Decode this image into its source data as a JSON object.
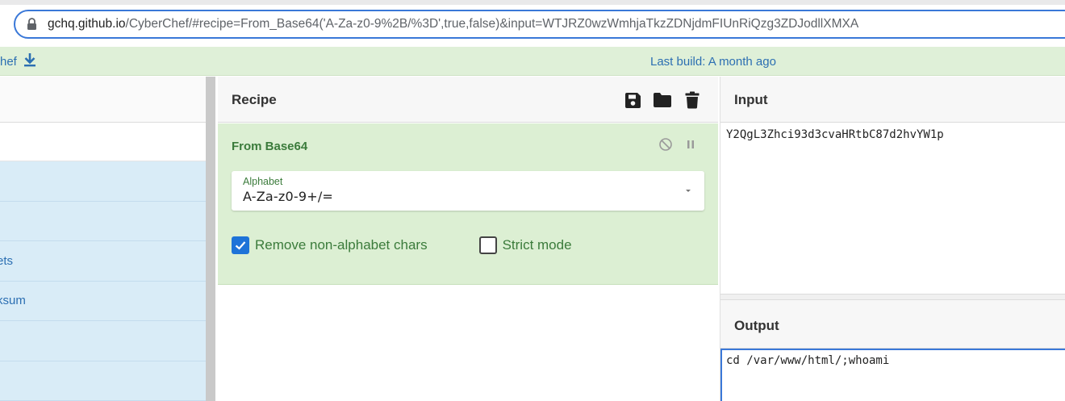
{
  "browser": {
    "url_host": "gchq.github.io",
    "url_path": "/CyberChef/#recipe=From_Base64('A-Za-z0-9%2B/%3D',true,false)&input=WTJRZ0wzWmhjaTkzZDNjdmFIUnRiQzg3ZDJodllXMXA"
  },
  "banner": {
    "left_text": "hef",
    "last_build": "Last build: A month ago"
  },
  "operations": {
    "items": [
      "",
      "",
      "ets",
      "ksum",
      "",
      ""
    ]
  },
  "recipe": {
    "title": "Recipe",
    "operation": {
      "name": "From Base64",
      "alphabet_label": "Alphabet",
      "alphabet_value": "A-Za-z0-9+/=",
      "remove_non_alphabet_label": "Remove non-alphabet chars",
      "remove_non_alphabet_checked": true,
      "strict_mode_label": "Strict mode",
      "strict_mode_checked": false
    }
  },
  "input": {
    "title": "Input",
    "value": "Y2QgL3Zhci93d3cvaHRtbC87d2hvYW1p"
  },
  "output": {
    "title": "Output",
    "value": "cd /var/www/html/;whoami"
  },
  "colors": {
    "accent_blue": "#3a78d8",
    "recipe_green": "#dcefd3",
    "banner_green": "#dff0d8",
    "ops_blue": "#d9ecf7",
    "label_green": "#3b7b3b"
  }
}
